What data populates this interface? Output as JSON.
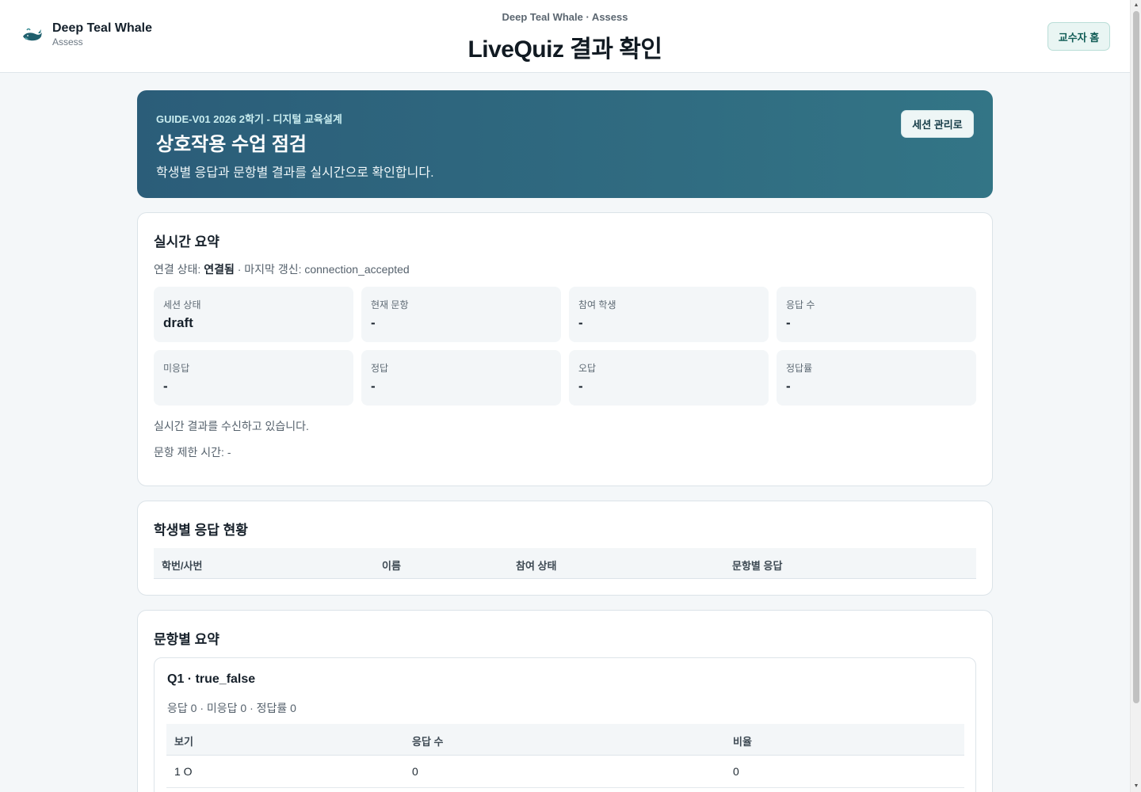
{
  "header": {
    "brand_name": "Deep Teal Whale",
    "brand_sub": "Assess",
    "eyebrow": "Deep Teal Whale · Assess",
    "title": "LiveQuiz 결과 확인",
    "home_button": "교수자 홈"
  },
  "hero": {
    "course": "GUIDE-V01 2026 2학기 - 디지털 교육설계",
    "title": "상호작용 수업 점검",
    "description": "학생별 응답과 문항별 결과를 실시간으로 확인합니다.",
    "manage_button": "세션 관리로"
  },
  "summary": {
    "title": "실시간 요약",
    "conn_prefix": "연결 상태: ",
    "conn_status": "연결됨",
    "conn_suffix": " · 마지막 갱신: connection_accepted",
    "stats": [
      {
        "label": "세션 상태",
        "value": "draft"
      },
      {
        "label": "현재 문항",
        "value": "-"
      },
      {
        "label": "참여 학생",
        "value": "-"
      },
      {
        "label": "응답 수",
        "value": "-"
      },
      {
        "label": "미응답",
        "value": "-"
      },
      {
        "label": "정답",
        "value": "-"
      },
      {
        "label": "오답",
        "value": "-"
      },
      {
        "label": "정답률",
        "value": "-"
      }
    ],
    "receiving_note": "실시간 결과를 수신하고 있습니다.",
    "time_limit_note": "문항 제한 시간: -"
  },
  "students": {
    "title": "학생별 응답 현황",
    "columns": [
      "학번/사번",
      "이름",
      "참여 상태",
      "문항별 응답"
    ]
  },
  "items": {
    "title": "문항별 요약",
    "questions": [
      {
        "title": "Q1 · true_false",
        "meta": "응답 0 · 미응답 0 · 정답률 0",
        "columns": [
          "보기",
          "응답 수",
          "비율"
        ],
        "rows": [
          {
            "option": "1 O",
            "count": "0",
            "ratio": "0"
          }
        ]
      }
    ]
  },
  "colors": {
    "accent": "#0f5b55",
    "hero_start": "#2b5d79",
    "hero_end": "#337586",
    "background": "#f4f7f9"
  }
}
